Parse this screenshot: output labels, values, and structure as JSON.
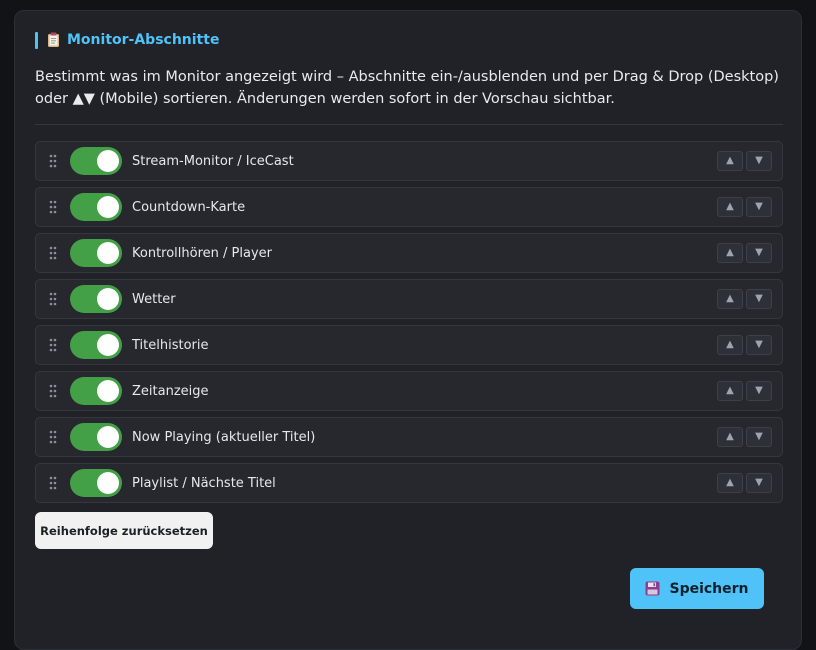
{
  "section": {
    "title": "Monitor-Abschnitte",
    "title_icon": "clipboard-icon",
    "description": "Bestimmt was im Monitor angezeigt wird – Abschnitte ein-/ausblenden und per Drag & Drop (Desktop) oder ▲▼ (Mobile) sortieren. Änderungen werden sofort in der Vorschau sichtbar."
  },
  "items": [
    {
      "label": "Stream-Monitor / IceCast",
      "enabled": true
    },
    {
      "label": "Countdown-Karte",
      "enabled": true
    },
    {
      "label": "Kontrollhören / Player",
      "enabled": true
    },
    {
      "label": "Wetter",
      "enabled": true
    },
    {
      "label": "Titelhistorie",
      "enabled": true
    },
    {
      "label": "Zeitanzeige",
      "enabled": true
    },
    {
      "label": "Now Playing (aktueller Titel)",
      "enabled": true
    },
    {
      "label": "Playlist / Nächste Titel",
      "enabled": true
    }
  ],
  "controls": {
    "move_up": "▲",
    "move_down": "▼"
  },
  "buttons": {
    "reset_label": "Reihenfolge zurücksetzen",
    "save_label": "Speichern",
    "save_icon": "floppy-disk-icon"
  },
  "colors": {
    "accent": "#4fc3f7",
    "toggle_on": "#43a047",
    "panel": "#202228",
    "background": "#121317"
  }
}
